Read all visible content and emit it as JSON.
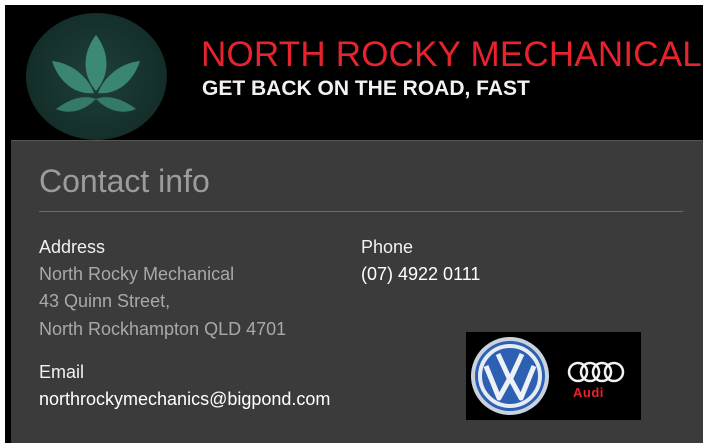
{
  "header": {
    "title": "NORTH ROCKY MECHANICAL",
    "tagline": "GET BACK ON THE ROAD, FAST",
    "logo_icon": "lotus-icon"
  },
  "contact": {
    "heading": "Contact info",
    "address": {
      "label": "Address",
      "lines": [
        "North Rocky Mechanical",
        "43 Quinn Street,",
        "North Rockhampton QLD 4701"
      ]
    },
    "phone": {
      "label": "Phone",
      "value": "(07) 4922 0111"
    },
    "email": {
      "label": "Email",
      "value": "northrockymechanics@bigpond.com"
    },
    "brand_logos": {
      "vw_icon": "volkswagen-logo-icon",
      "audi_icon": "audi-logo-icon",
      "audi_text": "Audi"
    }
  },
  "colors": {
    "brand_red": "#e8232d",
    "panel_bg": "#3b3b3b",
    "header_bg": "#000000"
  }
}
